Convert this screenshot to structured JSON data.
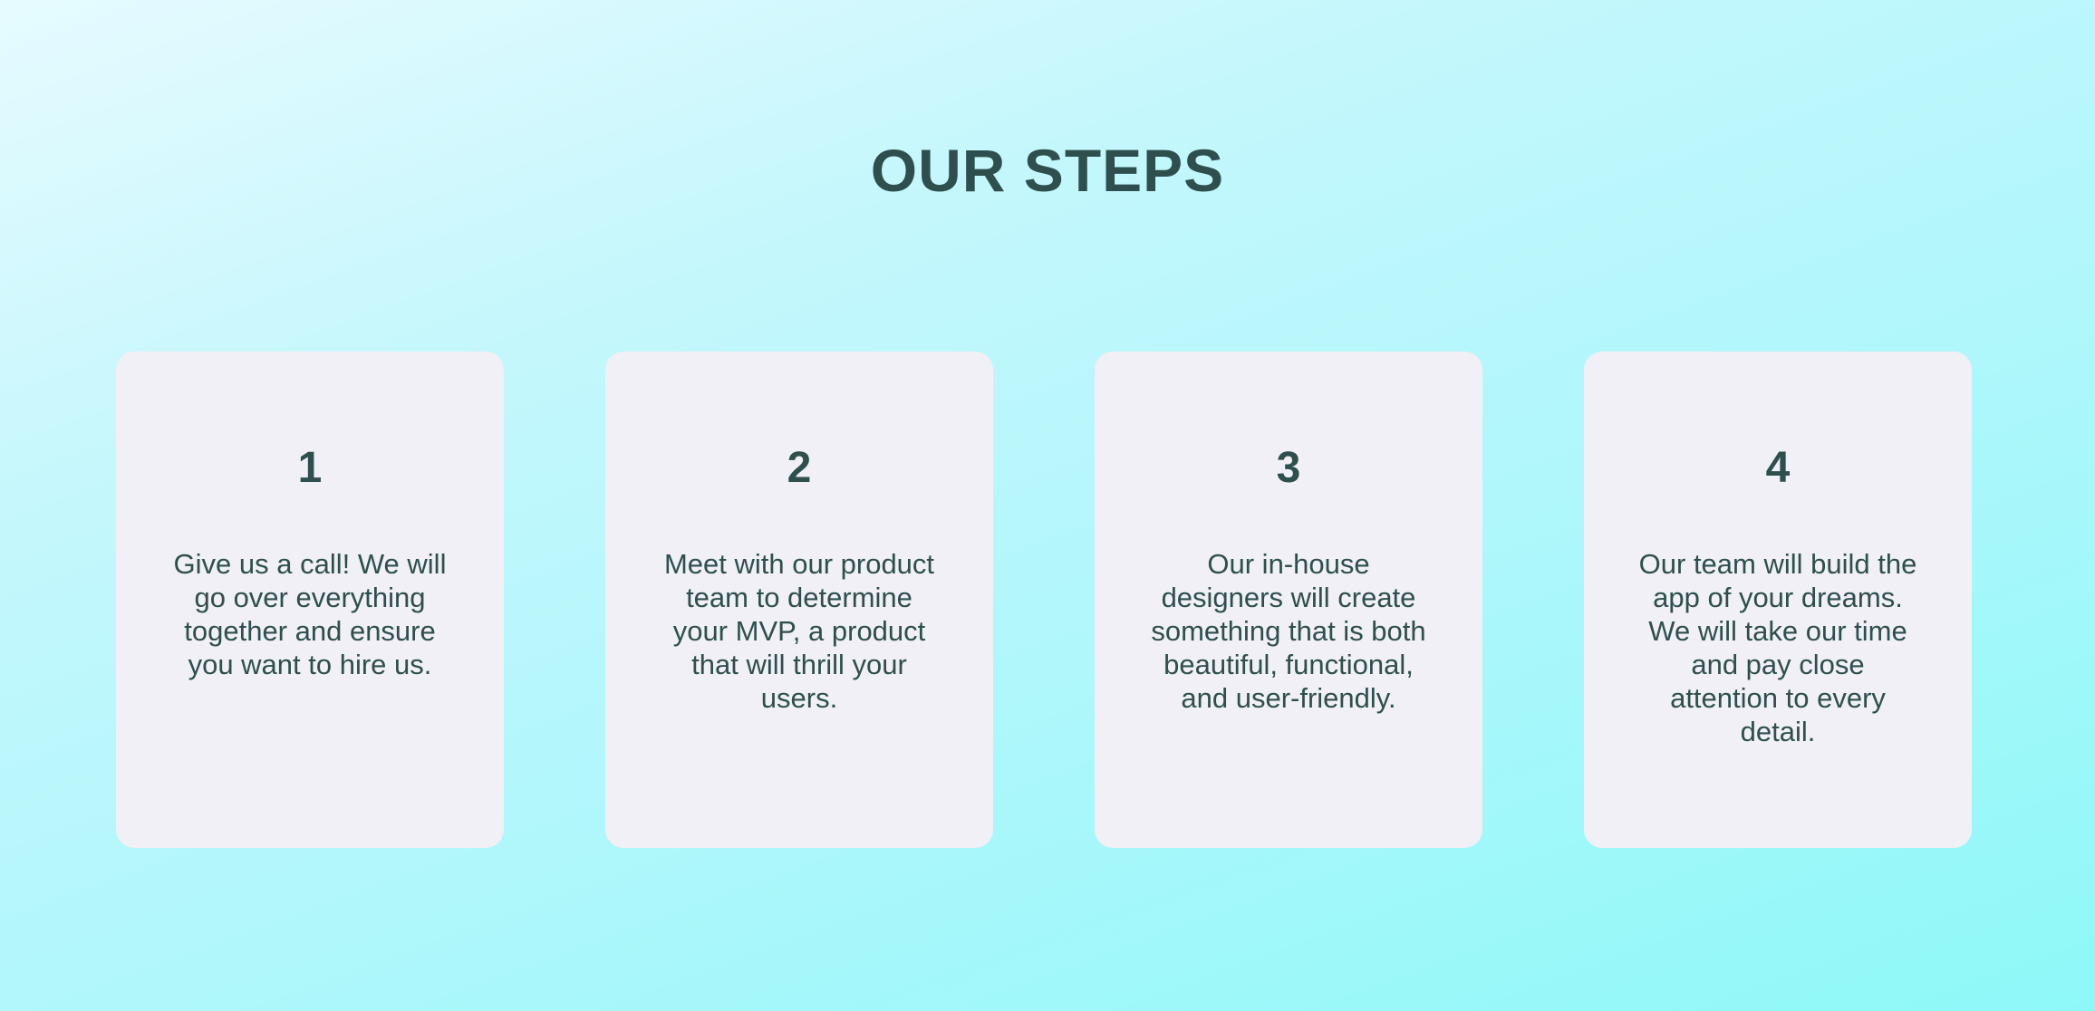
{
  "section": {
    "title": "OUR STEPS"
  },
  "steps": [
    {
      "number": "1",
      "text": "Give us a call! We will go over everything together and ensure you want to hire us."
    },
    {
      "number": "2",
      "text": "Meet with our product team to determine your MVP, a product that will thrill your users."
    },
    {
      "number": "3",
      "text": "Our in-house designers will create something that is both beautiful, functional, and user-friendly."
    },
    {
      "number": "4",
      "text": "Our team will build the app of your dreams. We will take our time and pay close attention to every detail."
    }
  ],
  "colors": {
    "text": "#2f4f4f",
    "card_background": "#f0f0f6",
    "background_start": "#e6fbff",
    "background_end": "#8ef8f8"
  }
}
